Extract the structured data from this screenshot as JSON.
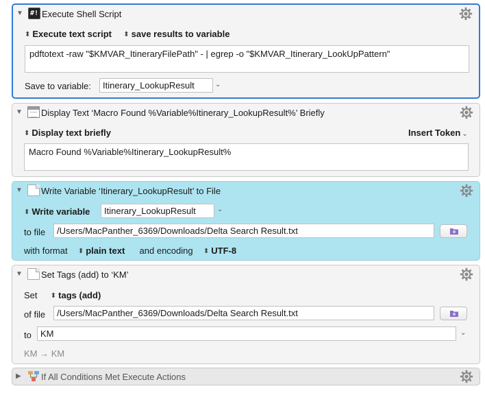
{
  "actions": [
    {
      "title": "Execute Shell Script",
      "mode_label": "Execute text script",
      "result_label": "save results to variable",
      "script_text": "pdftotext -raw \"$KMVAR_ItineraryFilePath\" - | egrep -o \"$KMVAR_Itinerary_LookUpPattern\"",
      "save_label": "Save to variable:",
      "save_variable": "Itinerary_LookupResult",
      "icon": "shell-script-icon"
    },
    {
      "title": "Display Text ‘Macro Found %Variable%Itinerary_LookupResult%’ Briefly",
      "mode_label": "Display text briefly",
      "insert_token_label": "Insert Token",
      "text_value": "Macro Found %Variable%Itinerary_LookupResult%",
      "icon": "display-text-icon"
    },
    {
      "title": "Write Variable ‘Itinerary_LookupResult’ to File",
      "mode_label": "Write variable",
      "variable_name": "Itinerary_LookupResult",
      "to_file_label": "to file",
      "file_path": "/Users/MacPanther_6369/Downloads/Delta Search Result.txt",
      "with_format_label": "with format",
      "format_value": "plain text",
      "and_encoding_label": "and encoding",
      "encoding_value": "UTF-8",
      "icon": "document-icon",
      "highlight_color": "#aee4f0"
    },
    {
      "title": "Set Tags (add) to ‘KM’",
      "set_label": "Set",
      "tags_mode": "tags (add)",
      "of_file_label": "of file",
      "file_path": "/Users/MacPanther_6369/Downloads/Delta Search Result.txt",
      "to_label": "to",
      "tags_value": "KM",
      "preview_text": "KM → KM",
      "icon": "document-icon"
    },
    {
      "title": "If All Conditions Met Execute Actions",
      "icon": "conditions-icon"
    }
  ],
  "colors": {
    "selected_border": "#2f7bd6",
    "gear": "#8a8a8a",
    "folder_button": "#8a6fc4"
  }
}
